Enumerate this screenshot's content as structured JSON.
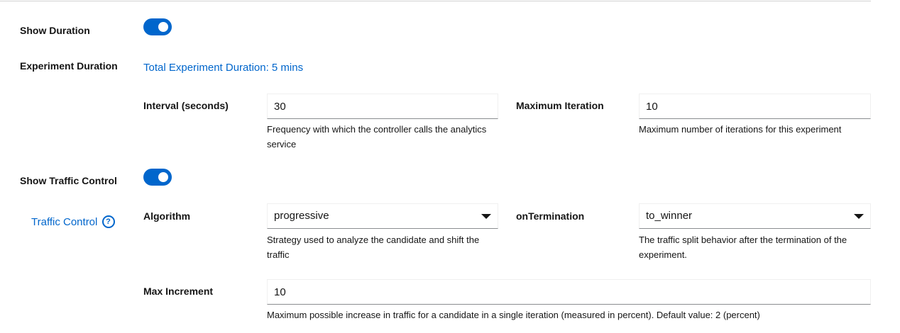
{
  "show_duration": {
    "label": "Show Duration",
    "enabled": true
  },
  "experiment_duration": {
    "label": "Experiment Duration",
    "total_text": "Total Experiment Duration: 5 mins"
  },
  "interval": {
    "label": "Interval (seconds)",
    "value": "30",
    "helper": "Frequency with which the controller calls the analytics service"
  },
  "max_iteration": {
    "label": "Maximum Iteration",
    "value": "10",
    "helper": "Maximum number of iterations for this experiment"
  },
  "show_traffic_control": {
    "label": "Show Traffic Control",
    "enabled": true
  },
  "traffic_control": {
    "label": "Traffic Control",
    "help_icon": "question-circle-icon"
  },
  "algorithm": {
    "label": "Algorithm",
    "value": "progressive",
    "helper": "Strategy used to analyze the candidate and shift the traffic"
  },
  "on_termination": {
    "label": "onTermination",
    "value": "to_winner",
    "helper": "The traffic split behavior after the termination of the experiment."
  },
  "max_increment": {
    "label": "Max Increment",
    "value": "10",
    "helper": "Maximum possible increase in traffic for a candidate in a single iteration (measured in percent). Default value: 2 (percent)"
  },
  "colors": {
    "accent": "#0066cc",
    "text": "#151515",
    "border": "#8a8d90"
  }
}
